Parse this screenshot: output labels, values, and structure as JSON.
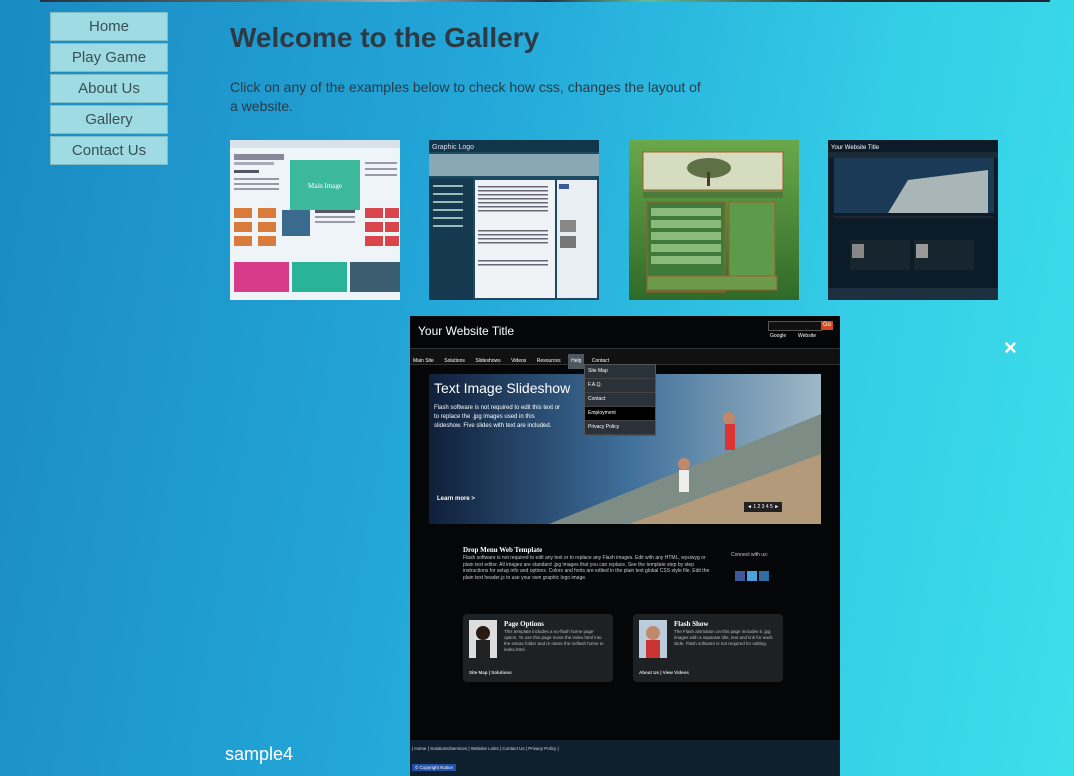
{
  "nav": {
    "items": [
      {
        "label": "Home"
      },
      {
        "label": "Play Game"
      },
      {
        "label": "About Us"
      },
      {
        "label": "Gallery"
      },
      {
        "label": "Contact Us"
      }
    ]
  },
  "page": {
    "title": "Welcome to the Gallery",
    "intro": "Click on any of the examples below to check how css, changes the layout of a website.",
    "caption": "sample4",
    "close_icon": "×"
  },
  "thumbnails": [
    {
      "label": "Main Image"
    },
    {
      "label": "Graphic Logo"
    },
    {
      "label": ""
    },
    {
      "label": "Your Website Title"
    }
  ],
  "lightbox": {
    "site_title": "Your Website Title",
    "go": "Go",
    "radio_google": "Google",
    "radio_website": "Website",
    "menu": [
      "Main Site",
      "Solutions",
      "Slideshows",
      "Videos",
      "Resources",
      "Help",
      "Contact"
    ],
    "dropdown": [
      "Site Map",
      "F.A.Q.",
      "Contact",
      "Employment",
      "Privacy Policy"
    ],
    "slide_title": "Text Image Slideshow",
    "slide_text": "Flash software is not required to edit this text or to replace the .jpg images used in this slideshow. Five slides with text are included.",
    "learn_more": "Learn more >",
    "pager": "◄ 1 2 3 4 5 ►",
    "section_heading": "Drop Menu Web Template",
    "section_text": "Flash software is not required to edit any text or to replace any Flash images. Edit with any HTML, wysiwyg or plain text editor. All images are standard .jpg images that you can replace. See the template step by step instructions for setup info and options. Colors and fonts are edited in the plain text global CSS style file. Edit the plain text header.js to use your own graphic logo image.",
    "connect": "Connect with us:",
    "box1_title": "Page Options",
    "box1_text": "This template includes a no-flash home page option. To use this page move the index.html into the extras folder and re name the noflash home to index.html.",
    "box1_link": "Site Map | Solutions",
    "box2_title": "Flash Show",
    "box2_text": "The Flash animation on this page includes 5 .jpg images with a separate title, text and link for each slide. Flash software is not required for editing.",
    "box2_link": "About Us | View Videos",
    "footer_links": "| Home | Solutions/Services | Website Links | Contact Us | Privacy Policy |",
    "copyright": "© Copyright Notice"
  }
}
